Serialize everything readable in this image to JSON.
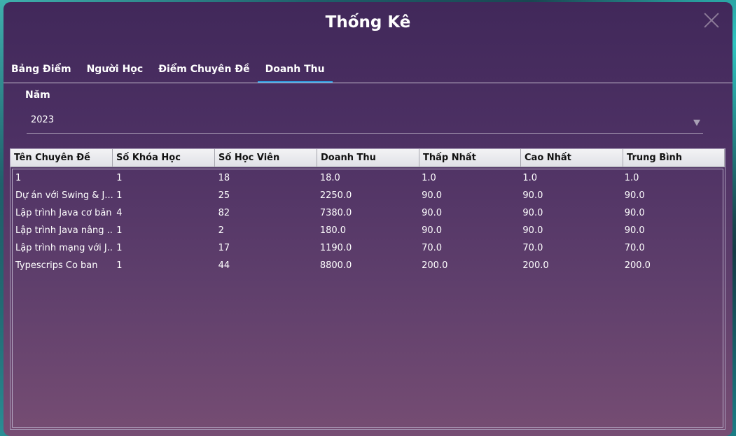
{
  "window": {
    "title": "Thống Kê"
  },
  "tabs": [
    {
      "label": "Bảng Điểm"
    },
    {
      "label": "Người Học"
    },
    {
      "label": "Điểm Chuyên Đề"
    },
    {
      "label": "Doanh Thu",
      "active": true
    }
  ],
  "filter": {
    "year_label": "Năm",
    "year_value": "2023"
  },
  "table": {
    "headers": [
      "Tên Chuyên Đề",
      "Số Khóa Học",
      "Số Học Viên",
      "Doanh Thu",
      "Thấp Nhất",
      "Cao Nhất",
      "Trung Bình"
    ],
    "rows": [
      [
        "1",
        "1",
        "18",
        "18.0",
        "1.0",
        "1.0",
        "1.0"
      ],
      [
        "Dự án với Swing & J...",
        "1",
        "25",
        "2250.0",
        "90.0",
        "90.0",
        "90.0"
      ],
      [
        "Lập trình Java cơ bản",
        "4",
        "82",
        "7380.0",
        "90.0",
        "90.0",
        "90.0"
      ],
      [
        "Lập trình Java nâng ...",
        "1",
        "2",
        "180.0",
        "90.0",
        "90.0",
        "90.0"
      ],
      [
        "Lập trình mạng với J...",
        "1",
        "17",
        "1190.0",
        "70.0",
        "70.0",
        "70.0"
      ],
      [
        "Typescrips Co ban",
        "1",
        "44",
        "8800.0",
        "200.0",
        "200.0",
        "200.0"
      ]
    ]
  },
  "colors": {
    "accent": "#2f9de0",
    "dialog_top": "#41285a",
    "dialog_bottom": "#764d73"
  },
  "icons": {
    "close": "close-icon",
    "dropdown": "chevron-down-icon"
  }
}
